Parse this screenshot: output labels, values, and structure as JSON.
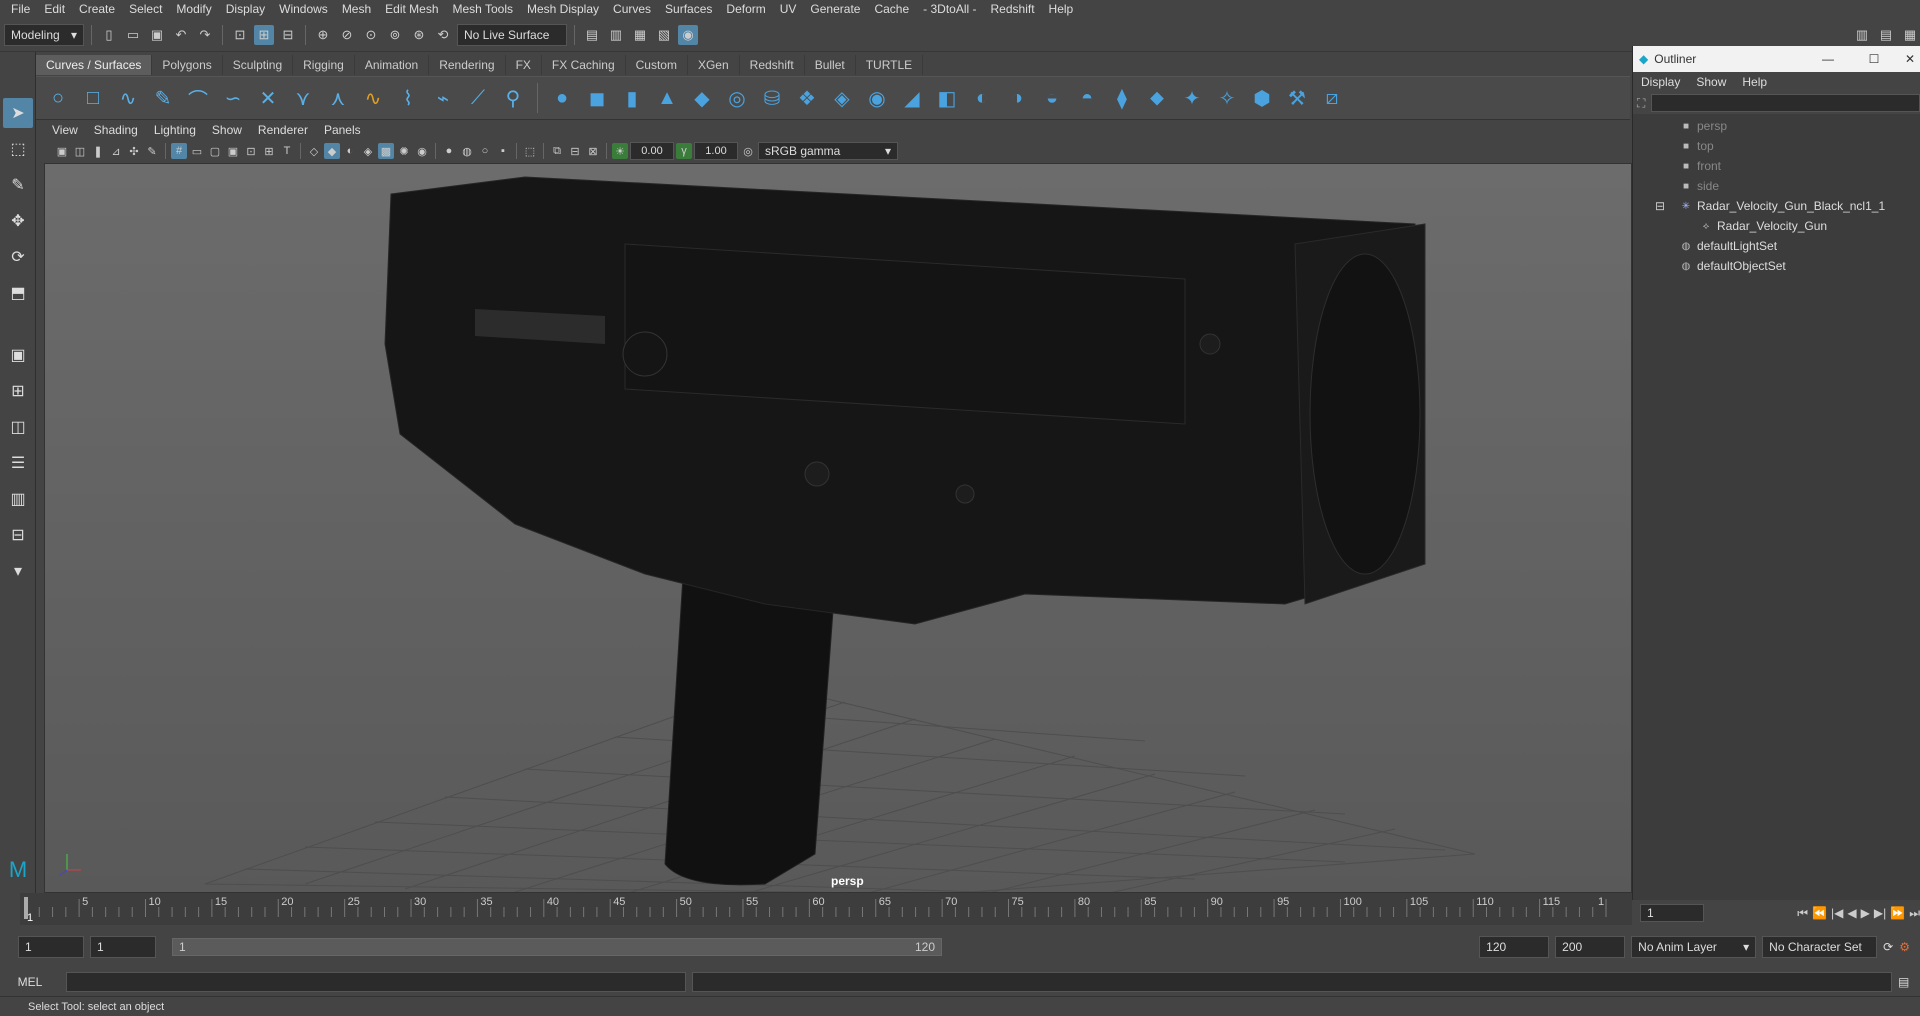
{
  "app": {
    "accent": "#5285a6",
    "background": "#444444"
  },
  "menu": [
    "File",
    "Edit",
    "Create",
    "Select",
    "Modify",
    "Display",
    "Windows",
    "Mesh",
    "Edit Mesh",
    "Mesh Tools",
    "Mesh Display",
    "Curves",
    "Surfaces",
    "Deform",
    "UV",
    "Generate",
    "Cache",
    "- 3DtoAll -",
    "Redshift",
    "Help"
  ],
  "status": {
    "mode": "Modeling",
    "live_surface": "No Live Surface"
  },
  "shelf_tabs": [
    "Curves / Surfaces",
    "Polygons",
    "Sculpting",
    "Rigging",
    "Animation",
    "Rendering",
    "FX",
    "FX Caching",
    "Custom",
    "XGen",
    "Redshift",
    "Bullet",
    "TURTLE"
  ],
  "panel_menu": [
    "View",
    "Shading",
    "Lighting",
    "Show",
    "Renderer",
    "Panels"
  ],
  "panel_toolbar": {
    "exposure": "0.00",
    "gamma": "1.00",
    "color_space": "sRGB gamma"
  },
  "viewport": {
    "camera_label": "persp"
  },
  "outliner": {
    "title": "Outliner",
    "menu": [
      "Display",
      "Show",
      "Help"
    ],
    "items": [
      {
        "label": "persp",
        "icon": "camera-icon",
        "dim": true
      },
      {
        "label": "top",
        "icon": "camera-icon",
        "dim": true
      },
      {
        "label": "front",
        "icon": "camera-icon",
        "dim": true
      },
      {
        "label": "side",
        "icon": "camera-icon",
        "dim": true
      },
      {
        "label": "Radar_Velocity_Gun_Black_ncl1_1",
        "icon": "group-icon",
        "dim": false
      },
      {
        "label": "Radar_Velocity_Gun",
        "icon": "mesh-icon",
        "dim": false
      },
      {
        "label": "defaultLightSet",
        "icon": "set-icon",
        "dim": false
      },
      {
        "label": "defaultObjectSet",
        "icon": "set-icon",
        "dim": false
      }
    ]
  },
  "timeline": {
    "ticks": [
      "5",
      "10",
      "15",
      "20",
      "25",
      "30",
      "35",
      "40",
      "45",
      "50",
      "55",
      "60",
      "65",
      "70",
      "75",
      "80",
      "85",
      "90",
      "95",
      "100",
      "105",
      "110",
      "115",
      "1"
    ],
    "current_frame": "1",
    "current_field": "1"
  },
  "range": {
    "start": "1",
    "start2": "1",
    "slider_start": "1",
    "slider_end": "120",
    "end": "120",
    "end2": "200",
    "anim_layer": "No Anim Layer",
    "char_set": "No Character Set"
  },
  "mel": {
    "label": "MEL"
  },
  "help_line": "Select Tool: select an object"
}
